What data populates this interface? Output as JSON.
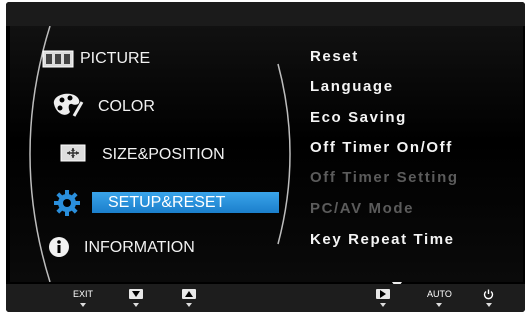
{
  "main_menu": {
    "items": [
      {
        "label": "PICTURE",
        "icon": "picture-icon"
      },
      {
        "label": "COLOR",
        "icon": "palette-icon"
      },
      {
        "label": "SIZE&POSITION",
        "icon": "size-position-icon"
      },
      {
        "label": "SETUP&RESET",
        "icon": "gear-icon",
        "selected": true
      },
      {
        "label": "INFORMATION",
        "icon": "info-icon"
      }
    ]
  },
  "submenu": {
    "items": [
      {
        "label": "Reset",
        "enabled": true
      },
      {
        "label": "Language",
        "enabled": true
      },
      {
        "label": "Eco Saving",
        "enabled": true
      },
      {
        "label": "Off Timer On/Off",
        "enabled": true
      },
      {
        "label": "Off Timer Setting",
        "enabled": false
      },
      {
        "label": "PC/AV Mode",
        "enabled": false
      },
      {
        "label": "Key Repeat Time",
        "enabled": true
      }
    ],
    "more_indicator": "down-arrow-icon"
  },
  "bottom_bar": {
    "buttons": [
      {
        "label": "EXIT",
        "icon": "exit-key"
      },
      {
        "label": "",
        "icon": "down-key-icon"
      },
      {
        "label": "",
        "icon": "up-key-icon"
      },
      {
        "label": "",
        "icon": "enter-key-icon"
      },
      {
        "label": "AUTO",
        "icon": "auto-key"
      },
      {
        "label": "",
        "icon": "power-icon"
      }
    ]
  },
  "colors": {
    "highlight": "#2a8fdc",
    "text": "#f2f2f2",
    "disabled_text": "#5b5b5b",
    "background": "#000000"
  }
}
